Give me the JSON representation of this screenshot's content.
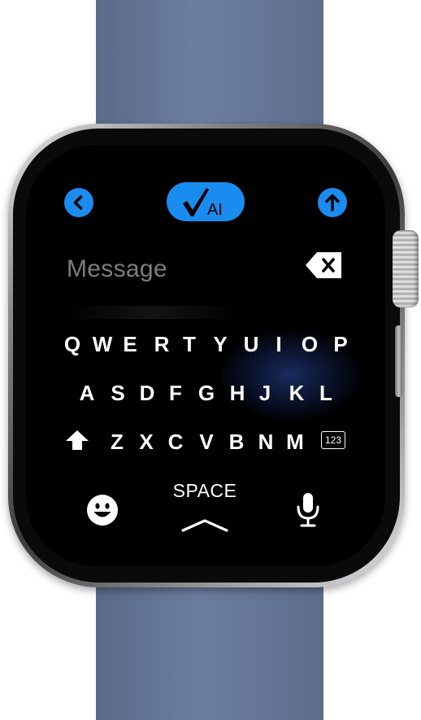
{
  "band": {
    "color": "#6b7d9d"
  },
  "accent_color": "#1a8cf0",
  "toolbar": {
    "back_icon": "chevron-left-icon",
    "ai_button": {
      "check_icon": "checkmark-icon",
      "label": "AI"
    },
    "send_icon": "arrow-up-icon"
  },
  "message": {
    "placeholder": "Message",
    "backspace_icon": "delete-left-icon"
  },
  "keyboard": {
    "row1": [
      "Q",
      "W",
      "E",
      "R",
      "T",
      "Y",
      "U",
      "I",
      "O",
      "P"
    ],
    "row2": [
      "A",
      "S",
      "D",
      "F",
      "G",
      "H",
      "J",
      "K",
      "L"
    ],
    "row3": [
      "Z",
      "X",
      "C",
      "V",
      "B",
      "N",
      "M"
    ],
    "shift_icon": "shift-arrow-icon",
    "numbers_label": "123",
    "emoji_icon": "smiley-face-icon",
    "space_label": "SPACE",
    "space_icon": "chevron-up-icon",
    "mic_icon": "microphone-icon"
  }
}
